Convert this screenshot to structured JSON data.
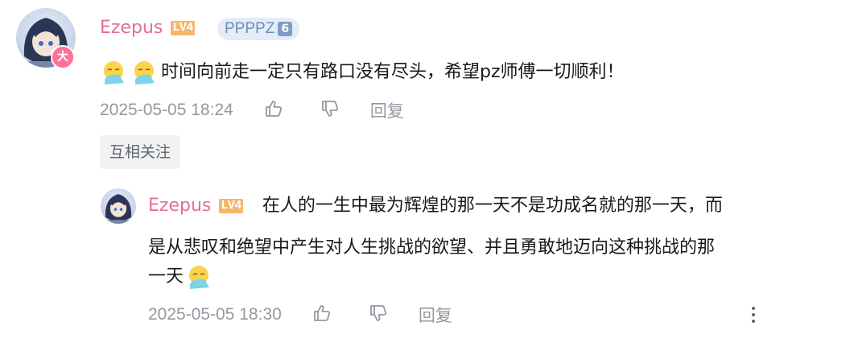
{
  "comment": {
    "username": "Ezepus",
    "level": "LV4",
    "vip_badge": "大",
    "fan_medal": {
      "name": "PPPPZ",
      "level": "6"
    },
    "emoji_names": [
      "facepalm-emoji",
      "facepalm-emoji"
    ],
    "text": "时间向前走一定只有路口没有尽头，希望pz师傅一切顺利！",
    "time": "2025-05-05 18:24",
    "reply_label": "回复",
    "follow_tag": "互相关注"
  },
  "reply": {
    "username": "Ezepus",
    "level": "LV4",
    "text_line1": "在人的一生中最为辉煌的那一天不是功成名就的那一天，而",
    "text_line2": "是从悲叹和绝望中产生对人生挑战的欲望、并且勇敢地迈向这种挑战的那",
    "text_line3": "一天",
    "emoji_name": "facepalm-emoji",
    "time": "2025-05-05 18:30",
    "reply_label": "回复"
  },
  "colors": {
    "username": "#e76f8f",
    "meta": "#9499a0",
    "fan_medal_bg": "#e3ecf7"
  }
}
